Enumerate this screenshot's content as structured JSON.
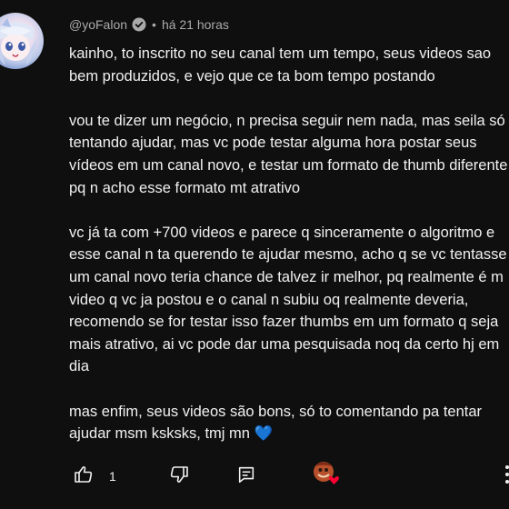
{
  "comment": {
    "author": "@yoFalon",
    "separator": "•",
    "timestamp": "há 21 horas",
    "paragraphs": [
      [
        "kainho, to inscrito no seu canal tem um tempo, seus videos sao",
        "bem produzidos, e vejo que ce ta bom tempo postando"
      ],
      [
        "vou te dizer um negócio, n precisa seguir nem nada, mas seila só",
        "tentando ajudar, mas vc pode testar alguma hora postar seus",
        "vídeos em um canal novo, e testar um formato de thumb diferente",
        "pq n acho esse formato mt atrativo"
      ],
      [
        "vc já ta com +700 videos e parece q sinceramente o algoritmo e",
        "esse canal n ta querendo te ajudar mesmo, acho q se vc tentasse",
        "um canal novo teria chance de talvez ir melhor, pq realmente é m",
        "video q vc ja postou e o canal n subiu oq realmente deveria,",
        "recomendo se for testar isso fazer thumbs em um formato q seja",
        "mais atrativo, ai vc pode dar uma pesquisada noq da certo hj em",
        "dia"
      ],
      [
        "mas enfim, seus videos são bons, só to comentando pa tentar",
        "ajudar msm ksksks, tmj mn 💙"
      ]
    ]
  },
  "actions": {
    "like_count": "1"
  },
  "icons": {
    "verified": "verified-check-icon",
    "like": "thumbs-up-icon",
    "dislike": "thumbs-down-icon",
    "reply": "reply-comment-icon",
    "creator_heart": "creator-heart-icon",
    "more": "more-vertical-icon"
  },
  "colors": {
    "background": "#0f0f0f",
    "text": "#f1f1f1",
    "meta": "#aaaaaa",
    "heart": "#ff0033"
  }
}
